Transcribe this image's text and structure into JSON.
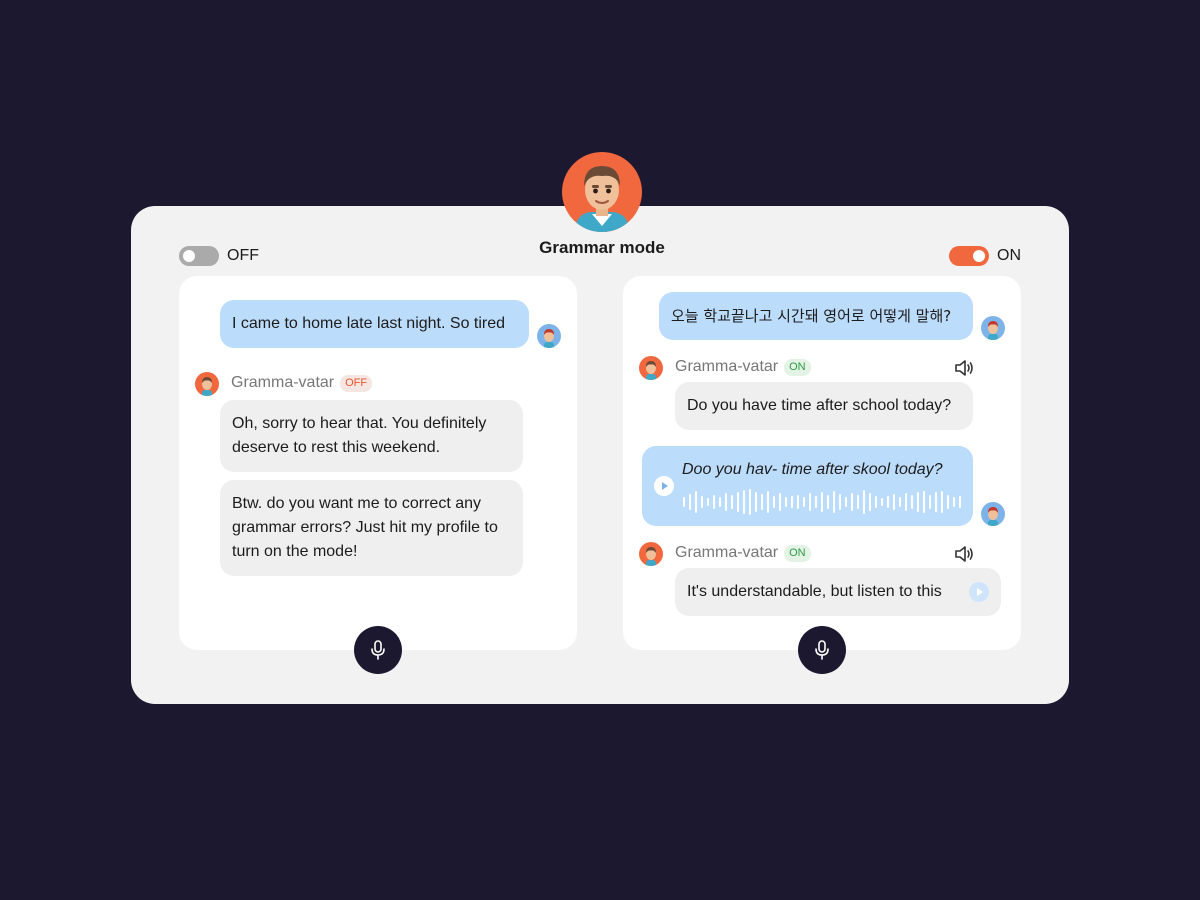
{
  "header": {
    "title": "Grammar mode",
    "toggle_off_label": "OFF",
    "toggle_on_label": "ON"
  },
  "left_chat": {
    "user_message": "I came to home late last night. So tired",
    "bot_name": "Gramma-vatar",
    "bot_badge": "OFF",
    "bot_messages": [
      "Oh, sorry to hear that. You definitely deserve to rest this weekend.",
      "Btw. do you want me to correct any grammar errors? Just hit my profile to turn on the mode!"
    ]
  },
  "right_chat": {
    "user_message": "오늘 학교끝나고 시간돼 영어로 어떻게 말해?",
    "bot_name": "Gramma-vatar",
    "bot_badge": "ON",
    "bot_reply_1": "Do you have time after school today?",
    "voice_message": "Doo you hav- time after skool today?",
    "bot_reply_2": "It's understandable, but listen to this"
  },
  "icons": {
    "mic": "mic-icon",
    "speaker": "speaker-icon",
    "play": "play-icon"
  },
  "colors": {
    "background": "#1c1830",
    "accent": "#f1683e",
    "user_bubble": "#bcdcfb",
    "bot_bubble": "#efefef",
    "on_badge": "#2e9a45",
    "off_badge": "#e8542a"
  }
}
